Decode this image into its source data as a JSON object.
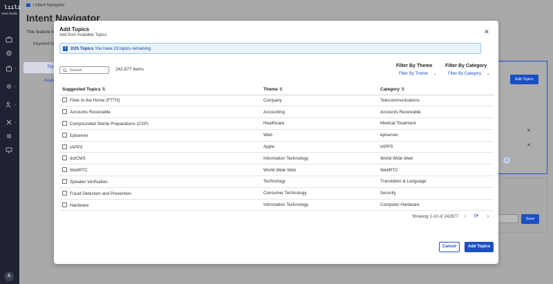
{
  "sidebar": {
    "logo": "lıılı",
    "app_name": "Data Studio",
    "icons": [
      "briefcase-icon",
      "gear-cluster-icon",
      "bag-icon",
      "settings-icon",
      "users-icon",
      "tools-icon",
      "list-icon",
      "monitor-icon"
    ],
    "avatar": "A"
  },
  "background": {
    "breadcrumb": "Intent Navigator",
    "title": "Intent Navigator",
    "description": "This feature ho",
    "tab": "Keyword In",
    "side_items": [
      "Topi",
      "Keyw"
    ],
    "edit_topics_label": "Edit Topics",
    "page_number": "1",
    "save_label": "Save"
  },
  "modal": {
    "title": "Add Topics",
    "subtitle": "Add from Available Topics",
    "close": "✕",
    "banner": {
      "count": "2/25 Topics",
      "remaining": "You have 23 topics remaining"
    },
    "search_placeholder": "Search",
    "items_count": "242,877 items",
    "filter_theme": {
      "label": "Filter By Theme",
      "value": "Filter By Theme"
    },
    "filter_category": {
      "label": "Filter By Category",
      "value": "Filter By Category"
    },
    "columns": [
      "Suggested Topics",
      "Theme",
      "Category"
    ],
    "rows": [
      [
        "Fiber to the Home (FTTH)",
        "Company",
        "Telecommunications"
      ],
      [
        "Accounts Receivable",
        "Accounting",
        "Accounts Receivable"
      ],
      [
        "Compounded Sterile Preparations (CSP)",
        "Healthcare",
        "Medical Treatment"
      ],
      [
        "Episerver",
        "Web",
        "episerver"
      ],
      [
        "IAPPS",
        "Apple",
        "IAPPS"
      ],
      [
        "dotCMS",
        "Information Technology",
        "World Wide Web"
      ],
      [
        "WebRTC",
        "World Wide Web",
        "WebRTC"
      ],
      [
        "Speaker Verifcation",
        "Technology",
        "Translation & Language"
      ],
      [
        "Fraud Detection and Prevention",
        "Consumer Technology",
        "Security"
      ],
      [
        "Hardware",
        "Information Technology",
        "Computer Hardware"
      ]
    ],
    "pager_text": "Showing 1-10 of 242877",
    "cancel_label": "Cancel",
    "add_label": "Add Topics"
  },
  "colors": {
    "accent": "#1b4fc4",
    "banner_bg": "#e9f3fd",
    "sidebar_bg": "#1f2230"
  }
}
